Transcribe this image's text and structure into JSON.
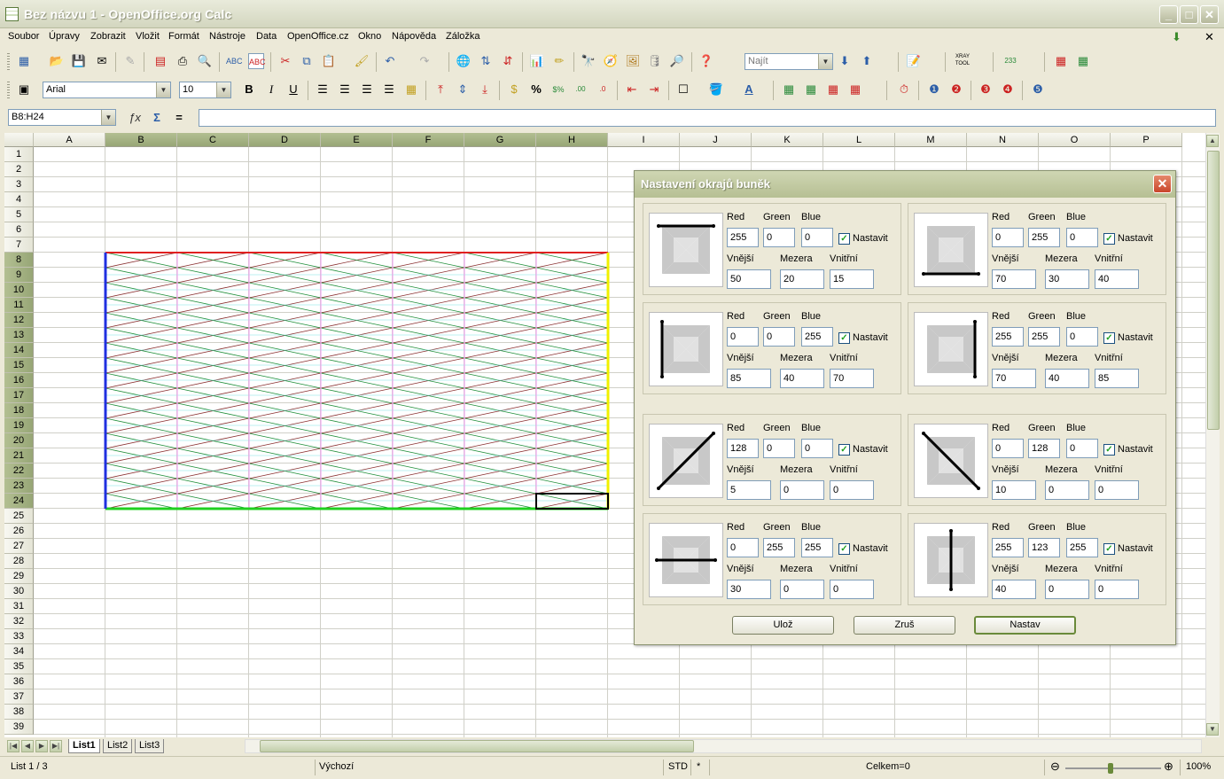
{
  "window": {
    "title": "Bez názvu 1 - OpenOffice.org Calc",
    "min": "_",
    "max": "□",
    "close": "✕"
  },
  "menu": [
    "Soubor",
    "Úpravy",
    "Zobrazit",
    "Vložit",
    "Formát",
    "Nástroje",
    "Data",
    "OpenOffice.cz",
    "Okno",
    "Nápověda",
    "Záložka"
  ],
  "toolbar": {
    "find_placeholder": "Najít",
    "font_name": "Arial",
    "font_size": "10"
  },
  "formula": {
    "cell_ref": "B8:H24",
    "value": ""
  },
  "columns": [
    "A",
    "B",
    "C",
    "D",
    "E",
    "F",
    "G",
    "H",
    "I",
    "J",
    "K",
    "L",
    "M",
    "N",
    "O",
    "P"
  ],
  "selected_columns": [
    "B",
    "C",
    "D",
    "E",
    "F",
    "G",
    "H"
  ],
  "selected_rows": [
    8,
    24
  ],
  "row_count": 39,
  "sheets": [
    "List1",
    "List2",
    "List3"
  ],
  "active_sheet": "List1",
  "status": {
    "sheet": "List 1 / 3",
    "style": "Výchozí",
    "mode": "STD",
    "modified": "*",
    "sum": "Celkem=0",
    "zoom": "100%"
  },
  "dialog": {
    "title": "Nastavení okrajů buněk",
    "labels": {
      "red": "Red",
      "green": "Green",
      "blue": "Blue",
      "set": "Nastavit",
      "outer": "Vnější",
      "gap": "Mezera",
      "inner": "Vnitřní"
    },
    "panels": [
      {
        "edge": "top",
        "red": "255",
        "green": "0",
        "blue": "0",
        "outer": "50",
        "gap": "20",
        "inner": "15"
      },
      {
        "edge": "bottom",
        "red": "0",
        "green": "255",
        "blue": "0",
        "outer": "70",
        "gap": "30",
        "inner": "40"
      },
      {
        "edge": "left",
        "red": "0",
        "green": "0",
        "blue": "255",
        "outer": "85",
        "gap": "40",
        "inner": "70"
      },
      {
        "edge": "right",
        "red": "255",
        "green": "255",
        "blue": "0",
        "outer": "70",
        "gap": "40",
        "inner": "85"
      },
      {
        "edge": "diag-up",
        "red": "128",
        "green": "0",
        "blue": "0",
        "outer": "5",
        "gap": "0",
        "inner": "0"
      },
      {
        "edge": "diag-down",
        "red": "0",
        "green": "128",
        "blue": "0",
        "outer": "10",
        "gap": "0",
        "inner": "0"
      },
      {
        "edge": "horizontal",
        "red": "0",
        "green": "255",
        "blue": "255",
        "outer": "30",
        "gap": "0",
        "inner": "0"
      },
      {
        "edge": "vertical",
        "red": "255",
        "green": "123",
        "blue": "255",
        "outer": "40",
        "gap": "0",
        "inner": "0"
      }
    ],
    "buttons": {
      "save": "Ulož",
      "cancel": "Zruš",
      "apply": "Nastav"
    }
  }
}
